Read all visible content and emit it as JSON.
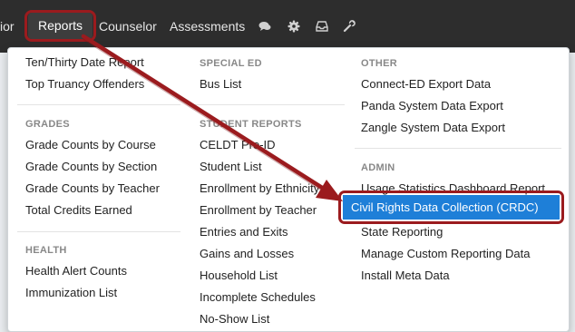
{
  "navbar": {
    "partial_left": "ior",
    "reports": "Reports",
    "counselor": "Counselor",
    "assessments": "Assessments"
  },
  "columns": {
    "col1": {
      "top_items": [
        "Ten/Thirty Date Report",
        "Top Truancy Offenders"
      ],
      "grades_heading": "GRADES",
      "grades_items": [
        "Grade Counts by Course",
        "Grade Counts by Section",
        "Grade Counts by Teacher",
        "Total Credits Earned"
      ],
      "health_heading": "HEALTH",
      "health_items": [
        "Health Alert Counts",
        "Immunization List"
      ]
    },
    "col2": {
      "special_ed_heading": "SPECIAL ED",
      "special_ed_items": [
        "Bus List"
      ],
      "student_reports_heading": "STUDENT REPORTS",
      "student_reports_items": [
        "CELDT Pre-ID",
        "Student List",
        "Enrollment by Ethnicity",
        "Enrollment by Teacher",
        "Entries and Exits",
        "Gains and Losses",
        "Household List",
        "Incomplete Schedules",
        "No-Show List"
      ]
    },
    "col3": {
      "other_heading": "OTHER",
      "other_items": [
        "Connect-ED Export Data",
        "Panda System Data Export",
        "Zangle System Data Export"
      ],
      "admin_heading": "ADMIN",
      "admin_items": [
        "Usage Statistics Dashboard Report",
        "Civil Rights Data Collection (CRDC)",
        "State Reporting",
        "Manage Custom Reporting Data",
        "Install Meta Data"
      ]
    }
  },
  "colors": {
    "navbar": "#2d2d2d",
    "highlight": "#1e7fd8",
    "annotation": "#9b1b1e"
  },
  "icons": [
    "comments-icon",
    "gear-icon",
    "inbox-icon",
    "wrench-icon"
  ]
}
